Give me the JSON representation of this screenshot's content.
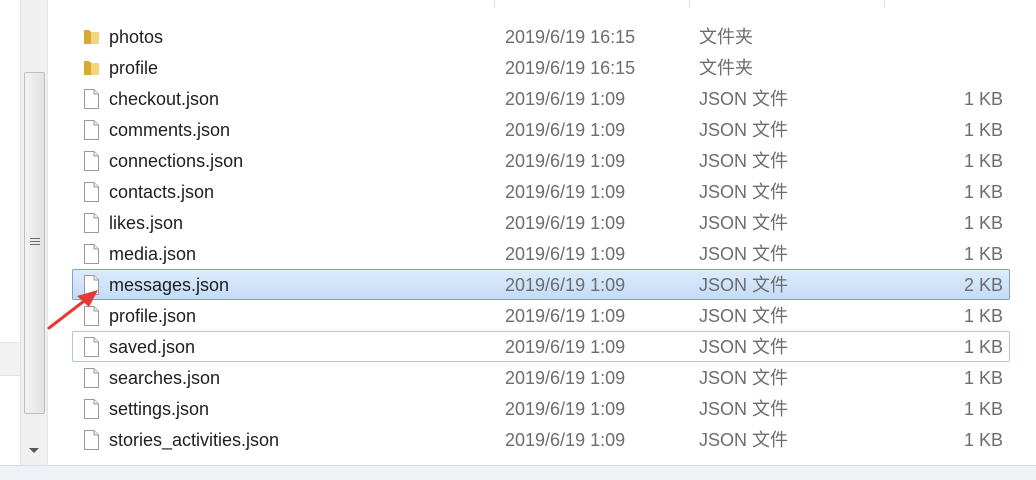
{
  "files": [
    {
      "name": "photos",
      "date": "2019/6/19 16:15",
      "type": "文件夹",
      "size": "",
      "icon": "folder-icon"
    },
    {
      "name": "profile",
      "date": "2019/6/19 16:15",
      "type": "文件夹",
      "size": "",
      "icon": "folder-icon"
    },
    {
      "name": "checkout.json",
      "date": "2019/6/19 1:09",
      "type": "JSON 文件",
      "size": "1 KB",
      "icon": "file-icon"
    },
    {
      "name": "comments.json",
      "date": "2019/6/19 1:09",
      "type": "JSON 文件",
      "size": "1 KB",
      "icon": "file-icon"
    },
    {
      "name": "connections.json",
      "date": "2019/6/19 1:09",
      "type": "JSON 文件",
      "size": "1 KB",
      "icon": "file-icon"
    },
    {
      "name": "contacts.json",
      "date": "2019/6/19 1:09",
      "type": "JSON 文件",
      "size": "1 KB",
      "icon": "file-icon"
    },
    {
      "name": "likes.json",
      "date": "2019/6/19 1:09",
      "type": "JSON 文件",
      "size": "1 KB",
      "icon": "file-icon"
    },
    {
      "name": "media.json",
      "date": "2019/6/19 1:09",
      "type": "JSON 文件",
      "size": "1 KB",
      "icon": "file-icon"
    },
    {
      "name": "messages.json",
      "date": "2019/6/19 1:09",
      "type": "JSON 文件",
      "size": "2 KB",
      "icon": "file-icon",
      "state": "selected"
    },
    {
      "name": "profile.json",
      "date": "2019/6/19 1:09",
      "type": "JSON 文件",
      "size": "1 KB",
      "icon": "file-icon"
    },
    {
      "name": "saved.json",
      "date": "2019/6/19 1:09",
      "type": "JSON 文件",
      "size": "1 KB",
      "icon": "file-icon",
      "state": "focused"
    },
    {
      "name": "searches.json",
      "date": "2019/6/19 1:09",
      "type": "JSON 文件",
      "size": "1 KB",
      "icon": "file-icon"
    },
    {
      "name": "settings.json",
      "date": "2019/6/19 1:09",
      "type": "JSON 文件",
      "size": "1 KB",
      "icon": "file-icon"
    },
    {
      "name": "stories_activities.json",
      "date": "2019/6/19 1:09",
      "type": "JSON 文件",
      "size": "1 KB",
      "icon": "file-icon"
    }
  ],
  "colors": {
    "selection": "#cce0f8",
    "selection_border": "#7da2ce",
    "annotation_arrow": "#e53935"
  }
}
